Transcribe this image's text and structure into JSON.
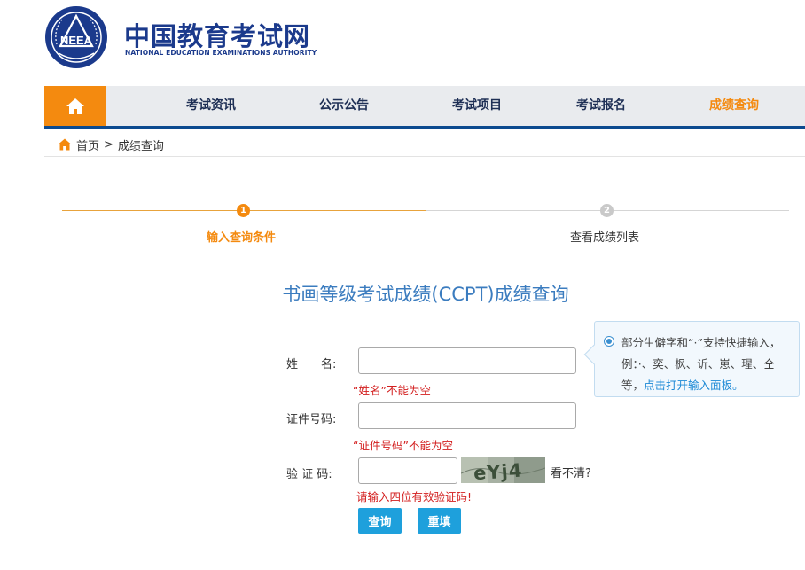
{
  "header": {
    "logo_text": "NEEA",
    "title": "中国教育考试网",
    "subtitle": "NATIONAL EDUCATION EXAMINATIONS AUTHORITY"
  },
  "nav": {
    "home_icon": "home-icon",
    "items": [
      {
        "label": "考试资讯"
      },
      {
        "label": "公示公告"
      },
      {
        "label": "考试项目"
      },
      {
        "label": "考试报名"
      },
      {
        "label": "成绩查询"
      }
    ],
    "active_index": 4
  },
  "breadcrumb": {
    "home": "首页",
    "separator": ">",
    "current": "成绩查询"
  },
  "steps": [
    {
      "number": "1",
      "label": "输入查询条件"
    },
    {
      "number": "2",
      "label": "查看成绩列表"
    }
  ],
  "form": {
    "title": "书画等级考试成绩(CCPT)成绩查询",
    "name_label": "姓　　名:",
    "name_value": "",
    "name_error": "“姓名”不能为空",
    "id_label": "证件号码:",
    "id_value": "",
    "id_error": "“证件号码”不能为空",
    "captcha_label": "验 证 码:",
    "captcha_value": "",
    "captcha_image_text": "eYj4",
    "unclear_label": "看不清?",
    "captcha_error": "请输入四位有效验证码!",
    "submit_label": "查询",
    "reset_label": "重填"
  },
  "tip": {
    "text_before_link": "部分生僻字和“·”支持快捷输入，例：·、奕、枫、䜣、崽、瑆、仝等，",
    "link_text": "点击打开输入面板。"
  },
  "colors": {
    "brand_blue": "#1b3a8c",
    "accent_orange": "#f48a0f",
    "nav_border": "#0c4a8f",
    "button_blue": "#1ea0dc",
    "error_red": "#d32020"
  }
}
